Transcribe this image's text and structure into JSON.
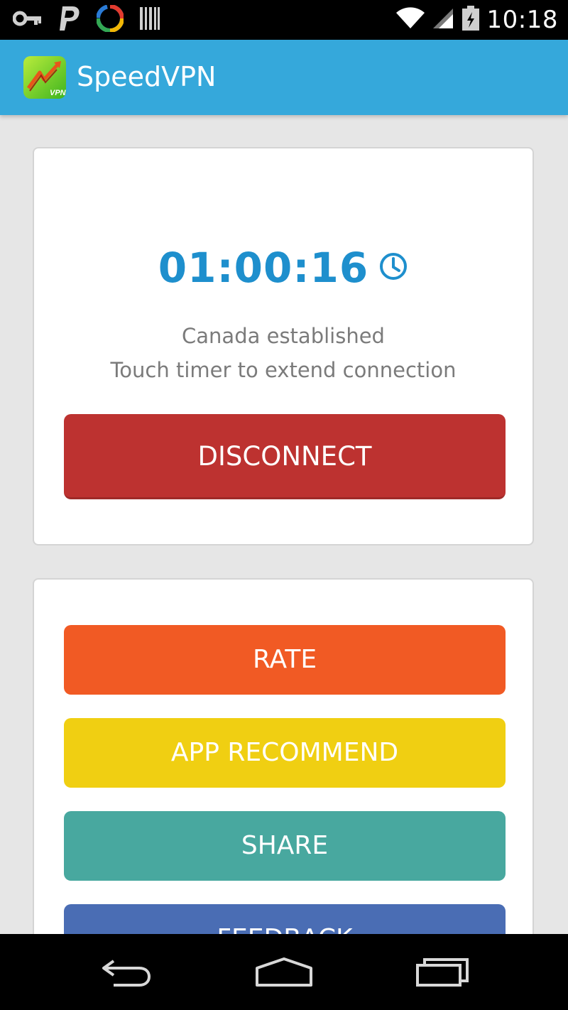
{
  "status_bar": {
    "time": "10:18",
    "left_icons": [
      "vpn-key-icon",
      "paypal-icon",
      "app-logo-icon",
      "barcode-icon"
    ],
    "right_icons": [
      "wifi-icon",
      "cellular-signal-icon",
      "battery-icon"
    ]
  },
  "app_bar": {
    "title": "SpeedVPN",
    "logo_text": "VPN"
  },
  "connection_card": {
    "timer": "01:00:16",
    "status_line": "Canada established",
    "hint_line": "Touch timer to extend connection",
    "disconnect_label": "DISCONNECT"
  },
  "actions_card": {
    "rate_label": "RATE",
    "app_recommend_label": "APP RECOMMEND",
    "share_label": "SHARE",
    "feedback_label": "FEEDBACK"
  },
  "colors": {
    "app_bar": "#35a8db",
    "timer": "#1e8fcd",
    "disconnect": "#bd3230",
    "rate": "#f15a24",
    "app_recommend": "#f0cf12",
    "share": "#48a89f",
    "feedback": "#4a6db4"
  }
}
